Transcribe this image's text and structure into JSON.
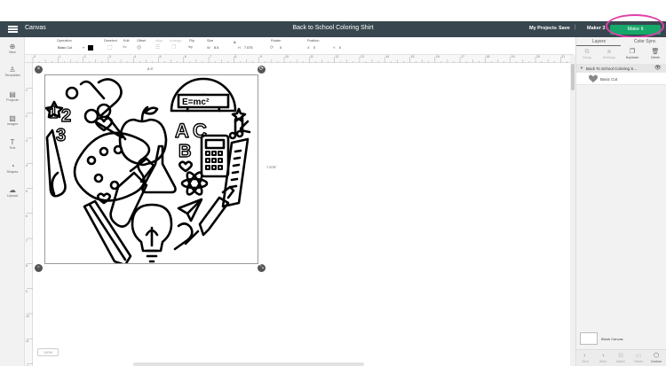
{
  "header": {
    "app_name": "Canvas",
    "document_title": "Back to School Coloring Shirt",
    "my_projects": "My Projects",
    "save": "Save",
    "machine": "Maker 3",
    "make_it": "Make It",
    "color_bg": "#38474f",
    "make_color": "#15a86a",
    "highlight_color": "#e040a8"
  },
  "toolbar": {
    "operation_label": "Operation",
    "operation_value": "Basic Cut",
    "deselect": "Deselect",
    "edit": "Edit",
    "offset": "Offset",
    "align": "Align",
    "arrange": "Arrange",
    "flip": "Flip",
    "size": "Size",
    "size_w_label": "W",
    "size_w": "8.5",
    "size_h_label": "H",
    "size_h": "7.575",
    "rotate": "Rotate",
    "rotate_value": "0",
    "position": "Position",
    "pos_x_label": "X",
    "pos_x": "0",
    "pos_y_label": "Y",
    "pos_y": "0"
  },
  "sidebar": {
    "items": [
      {
        "label": "New",
        "icon": "plus-icon"
      },
      {
        "label": "Templates",
        "icon": "shirt-icon"
      },
      {
        "label": "Projects",
        "icon": "projects-icon"
      },
      {
        "label": "Images",
        "icon": "image-icon"
      },
      {
        "label": "Text",
        "icon": "text-icon"
      },
      {
        "label": "Shapes",
        "icon": "shapes-icon"
      },
      {
        "label": "Upload",
        "icon": "upload-icon"
      }
    ]
  },
  "ruler": {
    "top": [
      "0",
      "1",
      "2",
      "3",
      "4",
      "5",
      "6",
      "7",
      "8",
      "9",
      "10",
      "11",
      "12",
      "13",
      "14",
      "15",
      "16",
      "17",
      "18",
      "19",
      "20",
      "21",
      "22",
      "23"
    ],
    "left": [
      "1",
      "2",
      "3",
      "4",
      "5",
      "6",
      "7",
      "8",
      "9",
      "10",
      "11",
      "12"
    ]
  },
  "canvas": {
    "width_label": "8.5\"",
    "height_label": "7.575\"",
    "zoom": "100%",
    "art_text": "E=mc²",
    "art_letters": [
      "A",
      "C",
      "B"
    ],
    "art_numbers": [
      "1",
      "2",
      "3"
    ]
  },
  "right_panel": {
    "tabs": [
      "Layers",
      "Color Sync"
    ],
    "actions": [
      "Group",
      "UnGroup",
      "Duplicate",
      "Delete"
    ],
    "layer_group_title": "Back To School Coloring S...",
    "layer_item": "Basic Cut",
    "blank_canvas": "Blank Canvas",
    "bottom_actions": [
      "Slice",
      "Weld",
      "Attach",
      "Flatten",
      "Contour"
    ]
  }
}
